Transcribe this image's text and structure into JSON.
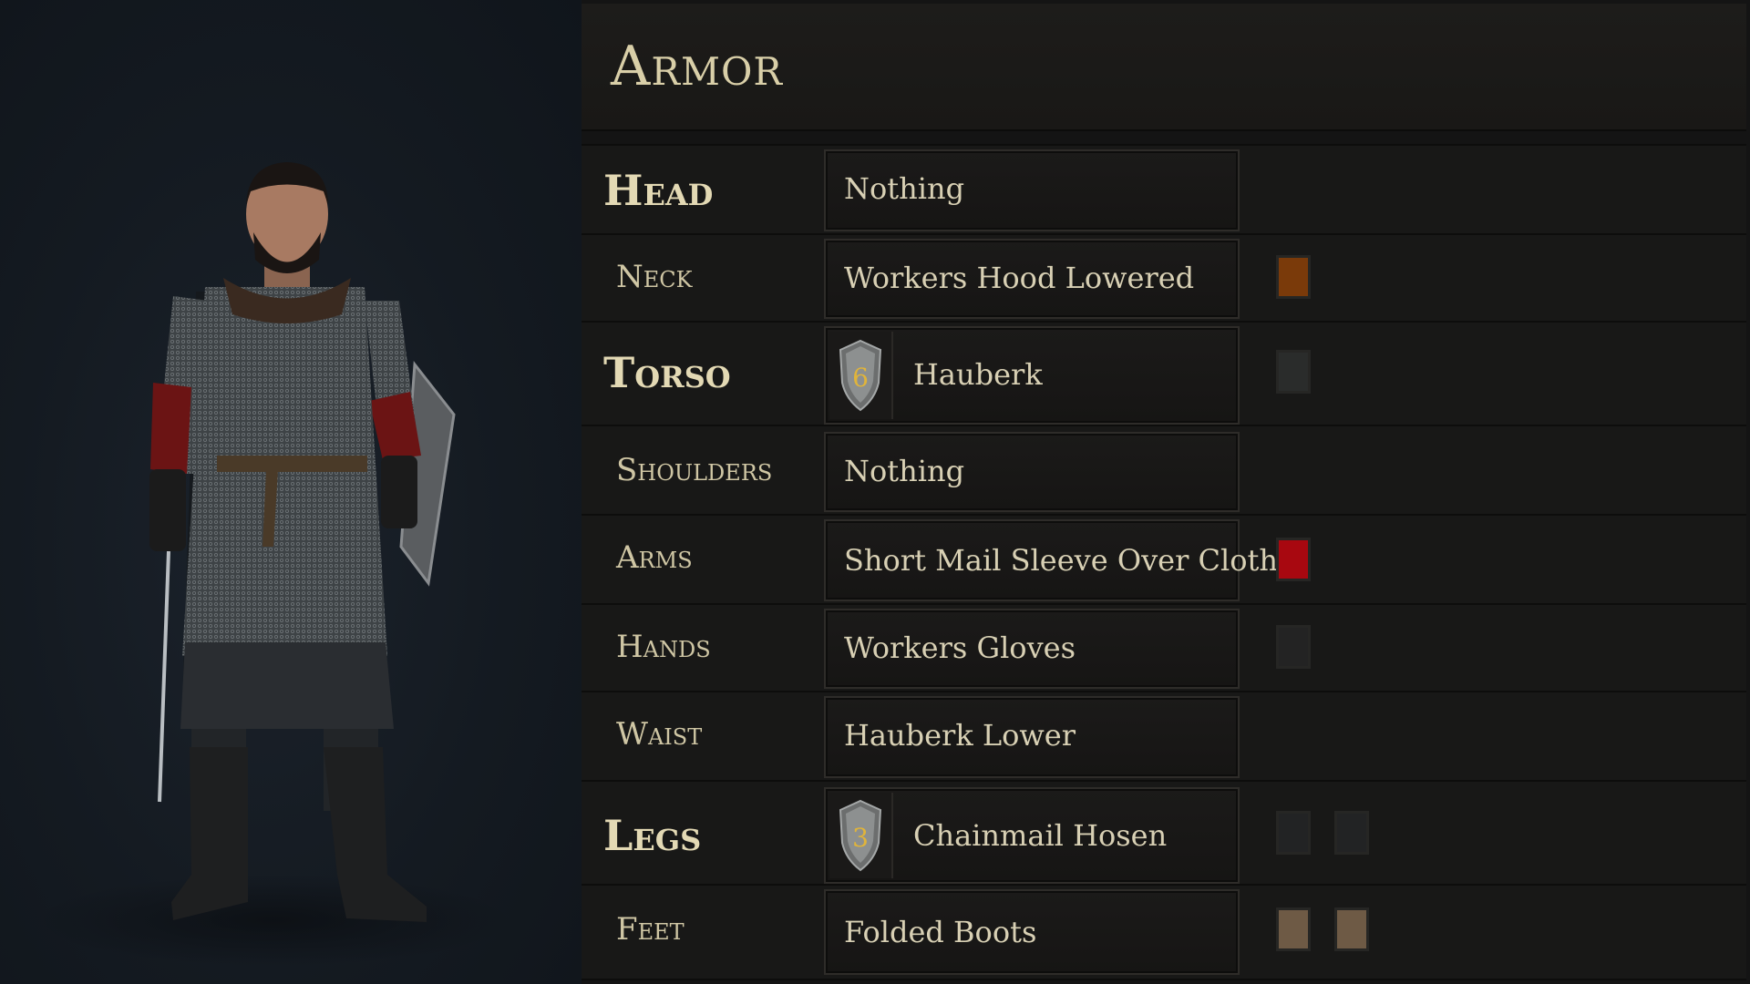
{
  "title": "Armor",
  "slots": [
    {
      "label": "Head",
      "item": "Nothing"
    },
    {
      "label": "Neck",
      "item": "Workers Hood Lowered",
      "colors": [
        "#7a3a0a"
      ]
    },
    {
      "label": "Torso",
      "item": "Hauberk",
      "armor_value": "6",
      "colors": [
        "#2a2c2b"
      ]
    },
    {
      "label": "Shoulders",
      "item": "Nothing"
    },
    {
      "label": "Arms",
      "item": "Short Mail Sleeve Over Cloth",
      "colors": [
        "#a80810"
      ]
    },
    {
      "label": "Hands",
      "item": "Workers Gloves",
      "colors": [
        "#232323"
      ]
    },
    {
      "label": "Waist",
      "item": "Hauberk Lower"
    },
    {
      "label": "Legs",
      "item": "Chainmail Hosen",
      "armor_value": "3",
      "colors": [
        "#222324",
        "#222324"
      ]
    },
    {
      "label": "Feet",
      "item": "Folded Boots",
      "colors": [
        "#6e5a45",
        "#6e5a45"
      ]
    }
  ],
  "icons": {
    "armor_value": "shield-icon"
  }
}
